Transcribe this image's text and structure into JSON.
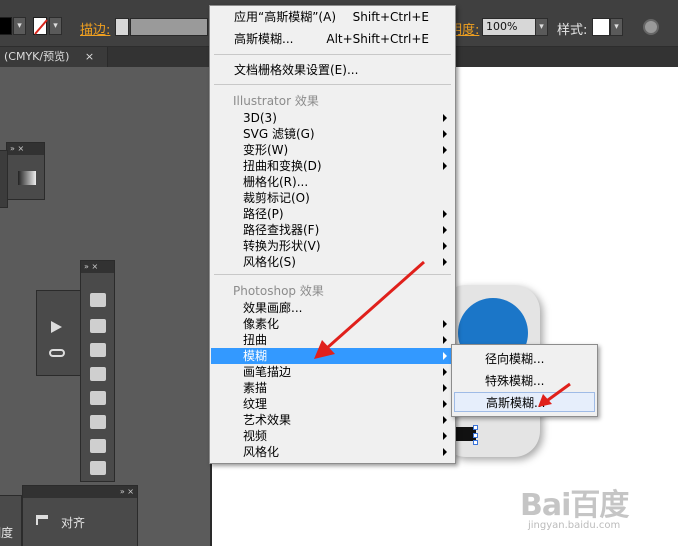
{
  "toolbar": {
    "stroke_label": "描边:",
    "opacity_label": "明度:",
    "opacity_value": "100%",
    "style_label": "样式:"
  },
  "document_tab": {
    "title": "(CMYK/预览)",
    "close": "×"
  },
  "effect_menu": {
    "apply_last": {
      "label": "应用“高斯模糊”(A)",
      "shortcut": "Shift+Ctrl+E"
    },
    "last_effect": {
      "label": "高斯模糊...",
      "shortcut": "Alt+Shift+Ctrl+E"
    },
    "raster_settings": "文档栅格效果设置(E)...",
    "illustrator_header": "Illustrator 效果",
    "illustrator_items": [
      "3D(3)",
      "SVG 滤镜(G)",
      "变形(W)",
      "扭曲和变换(D)",
      "栅格化(R)...",
      "裁剪标记(O)",
      "路径(P)",
      "路径查找器(F)",
      "转换为形状(V)",
      "风格化(S)"
    ],
    "photoshop_header": "Photoshop 效果",
    "photoshop_items": [
      "效果画廊...",
      "像素化",
      "扭曲",
      "模糊",
      "画笔描边",
      "素描",
      "纹理",
      "艺术效果",
      "视频",
      "风格化"
    ],
    "highlighted_item": "模糊"
  },
  "blur_submenu": {
    "items": [
      "径向模糊...",
      "特殊模糊...",
      "高斯模糊..."
    ],
    "hovered_item": "高斯模糊..."
  },
  "panels": {
    "header_glyphs": "» ×",
    "align_label": "对齐",
    "partial_left_label": "明度"
  },
  "watermark": {
    "logo": "Bai百度",
    "url": "jingyan.baidu.com"
  },
  "colors": {
    "menu_highlight": "#3399ff",
    "arrow_red": "#e0201b",
    "icon_blue": "#1b76c8"
  }
}
